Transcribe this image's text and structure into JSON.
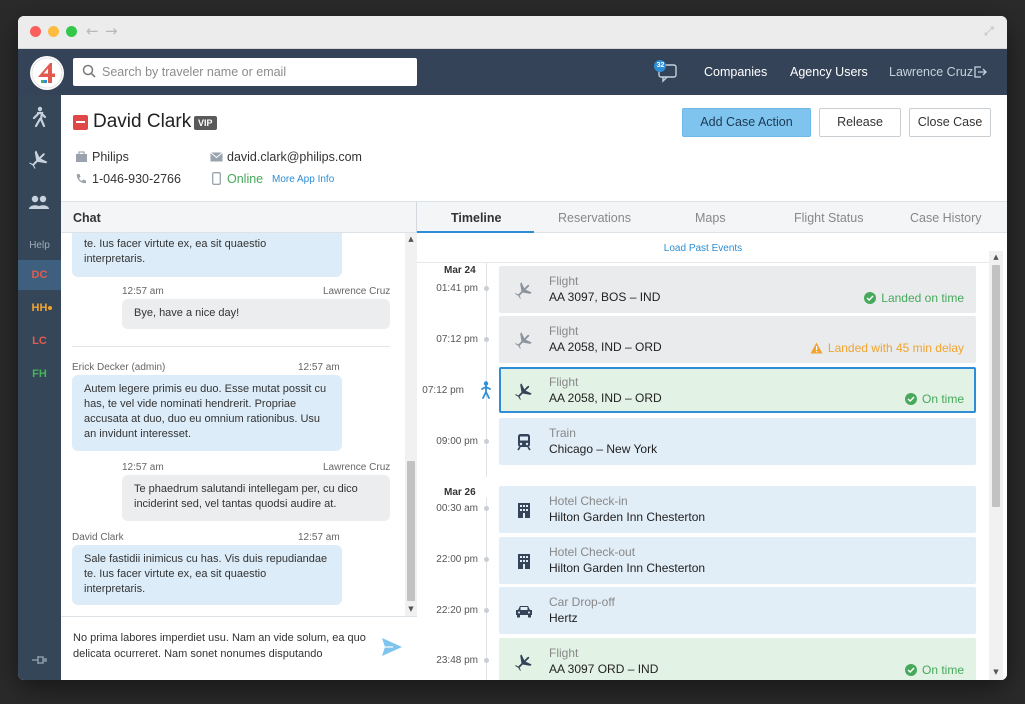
{
  "app": {
    "logo_text": "4"
  },
  "search": {
    "placeholder": "Search by traveler name or email"
  },
  "topnav": {
    "companies": "Companies",
    "agency_users": "Agency Users",
    "user": "Lawrence Cruz",
    "chat_badge": "32"
  },
  "sidebar": {
    "help": "Help",
    "codes": [
      {
        "label": "DC",
        "color": "#e25b4e"
      },
      {
        "label": "HH",
        "color": "#f0a531"
      },
      {
        "label": "LC",
        "color": "#e25b4e"
      },
      {
        "label": "FH",
        "color": "#46b45a"
      }
    ]
  },
  "case": {
    "name": "David Clark",
    "vip": "VIP",
    "company": "Philips",
    "phone": "1-046-930-2766",
    "email": "david.clark@philips.com",
    "status": "Online",
    "more_info": "More App Info",
    "buttons": {
      "add_action": "Add Case Action",
      "release": "Release",
      "close": "Close Case"
    }
  },
  "chat": {
    "title": "Chat",
    "messages": [
      {
        "text": "te. Ius facer virtute ex, ea sit quaestio interpretaris."
      },
      {
        "sender": "Lawrence Cruz",
        "time": "12:57 am",
        "text": "Bye, have a nice day!"
      },
      {
        "sender": "Erick Decker (admin)",
        "time": "12:57 am",
        "text": "Autem legere primis eu duo. Esse mutat possit cu has, te vel vide nominati hendrerit. Propriae accusata at duo, duo eu omnium rationibus. Usu an invidunt interesset."
      },
      {
        "sender": "Lawrence Cruz",
        "time": "12:57 am",
        "text": "Te phaedrum salutandi intellegam per, cu dico inciderint sed, vel tantas quodsi audire at."
      },
      {
        "sender": "David Clark",
        "time": "12:57 am",
        "text": "Sale fastidii inimicus cu has. Vis duis repudiandae te. Ius facer virtute ex, ea sit quaestio interpretaris."
      }
    ],
    "composer_text": "No prima labores imperdiet usu. Nam an vide solum, ea quo delicata ocurreret. Nam sonet nonumes disputando"
  },
  "timeline": {
    "tabs": [
      "Timeline",
      "Reservations",
      "Maps",
      "Flight Status",
      "Case History"
    ],
    "load_past": "Load Past Events",
    "days": [
      "Mar 24",
      "Mar 26"
    ],
    "events": [
      {
        "time": "01:41 pm",
        "kind": "Flight",
        "detail": "AA 3097, BOS – IND",
        "status": "Landed on time",
        "status_type": "ok",
        "icon": "plane-icon"
      },
      {
        "time": "07:12 pm",
        "kind": "Flight",
        "detail": "AA 2058, IND – ORD",
        "status": "Landed with 45 min delay",
        "status_type": "warn",
        "icon": "plane-icon"
      },
      {
        "time": "07:12 pm",
        "kind": "Flight",
        "detail": "AA 2058, IND – ORD",
        "status": "On time",
        "status_type": "ok",
        "icon": "plane-icon"
      },
      {
        "time": "09:00 pm",
        "kind": "Train",
        "detail": "Chicago – New York",
        "status": "",
        "status_type": "",
        "icon": "train-icon"
      },
      {
        "time": "00:30 am",
        "kind": "Hotel Check-in",
        "detail": "Hilton Garden Inn Chesterton",
        "status": "",
        "status_type": "",
        "icon": "hotel-icon"
      },
      {
        "time": "22:00 pm",
        "kind": "Hotel Check-out",
        "detail": "Hilton Garden Inn Chesterton",
        "status": "",
        "status_type": "",
        "icon": "hotel-icon"
      },
      {
        "time": "22:20 pm",
        "kind": "Car Drop-off",
        "detail": "Hertz",
        "status": "",
        "status_type": "",
        "icon": "car-icon"
      },
      {
        "time": "23:48 pm",
        "kind": "Flight",
        "detail": "AA 3097 ORD – IND",
        "status": "On time",
        "status_type": "ok",
        "icon": "plane-icon"
      }
    ]
  },
  "colors": {
    "accent": "#2d8dd6",
    "ok": "#46a95b",
    "warn": "#f0a531",
    "danger": "#e04848",
    "nav": "#344357",
    "primary_button": "#7ec4ef"
  }
}
